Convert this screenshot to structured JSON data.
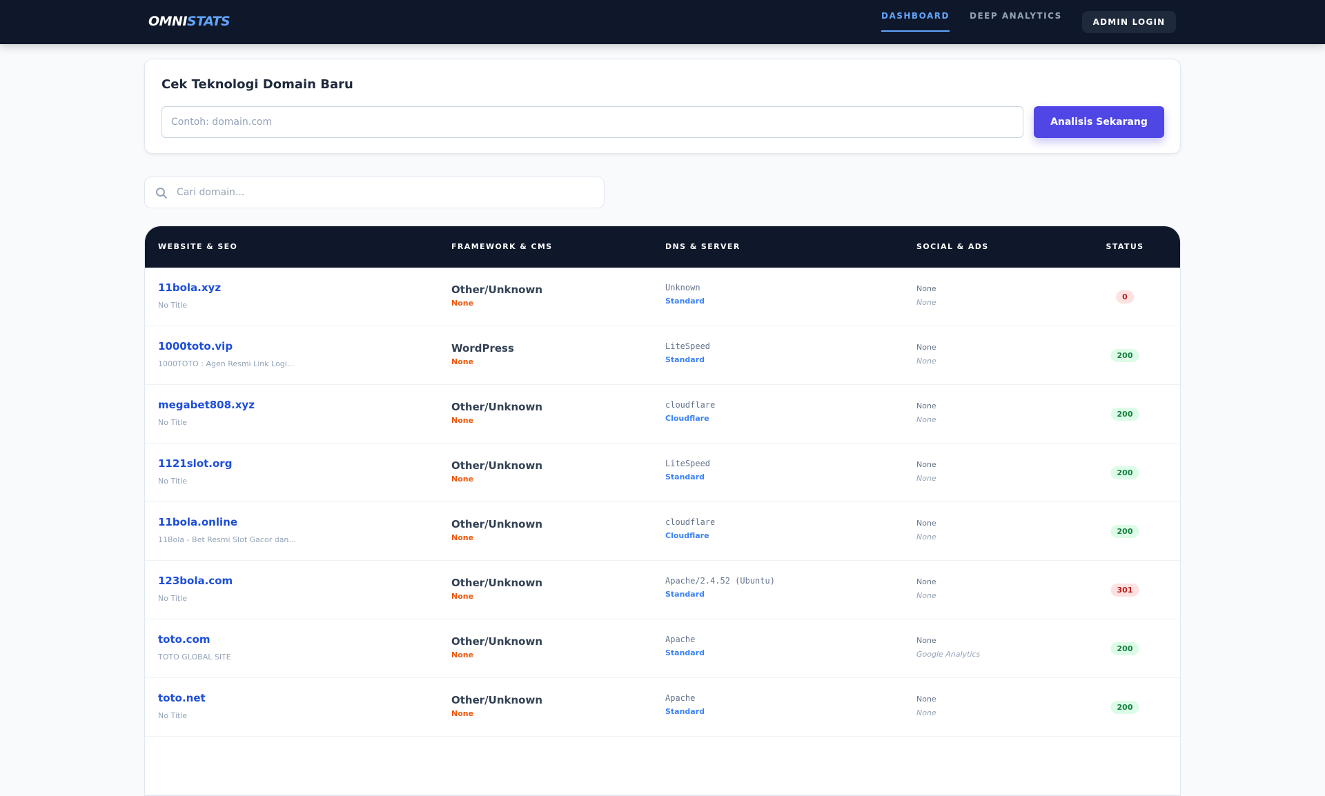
{
  "nav": {
    "logo_a": "OMNI",
    "logo_b": "STATS",
    "links": [
      "DASHBOARD",
      "DEEP ANALYTICS"
    ],
    "admin": "ADMIN LOGIN"
  },
  "checker": {
    "title": "Cek Teknologi Domain Baru",
    "placeholder": "Contoh: domain.com",
    "button": "Analisis Sekarang"
  },
  "search": {
    "placeholder": "Cari domain..."
  },
  "table": {
    "headers": [
      "WEBSITE & SEO",
      "FRAMEWORK & CMS",
      "DNS & SERVER",
      "SOCIAL & ADS",
      "STATUS"
    ],
    "rows": [
      {
        "domain": "11bola.xyz",
        "title": "No Title",
        "framework": "Other/Unknown",
        "cms": "None",
        "server": "Unknown",
        "dns": "Standard",
        "social": "None",
        "ads": "None",
        "status": "0"
      },
      {
        "domain": "1000toto.vip",
        "title": "1000TOTO : Agen Resmi Link Logi...",
        "framework": "WordPress",
        "cms": "None",
        "server": "LiteSpeed",
        "dns": "Standard",
        "social": "None",
        "ads": "None",
        "status": "200"
      },
      {
        "domain": "megabet808.xyz",
        "title": "No Title",
        "framework": "Other/Unknown",
        "cms": "None",
        "server": "cloudflare",
        "dns": "Cloudflare",
        "social": "None",
        "ads": "None",
        "status": "200"
      },
      {
        "domain": "1121slot.org",
        "title": "No Title",
        "framework": "Other/Unknown",
        "cms": "None",
        "server": "LiteSpeed",
        "dns": "Standard",
        "social": "None",
        "ads": "None",
        "status": "200"
      },
      {
        "domain": "11bola.online",
        "title": "11Bola - Bet Resmi Slot Gacor dan...",
        "framework": "Other/Unknown",
        "cms": "None",
        "server": "cloudflare",
        "dns": "Cloudflare",
        "social": "None",
        "ads": "None",
        "status": "200"
      },
      {
        "domain": "123bola.com",
        "title": "No Title",
        "framework": "Other/Unknown",
        "cms": "None",
        "server": "Apache/2.4.52 (Ubuntu)",
        "dns": "Standard",
        "social": "None",
        "ads": "None",
        "status": "301"
      },
      {
        "domain": "toto.com",
        "title": "TOTO GLOBAL SITE",
        "framework": "Other/Unknown",
        "cms": "None",
        "server": "Apache",
        "dns": "Standard",
        "social": "None",
        "ads": "Google Analytics",
        "status": "200"
      },
      {
        "domain": "toto.net",
        "title": "No Title",
        "framework": "Other/Unknown",
        "cms": "None",
        "server": "Apache",
        "dns": "Standard",
        "social": "None",
        "ads": "None",
        "status": "200"
      }
    ]
  }
}
